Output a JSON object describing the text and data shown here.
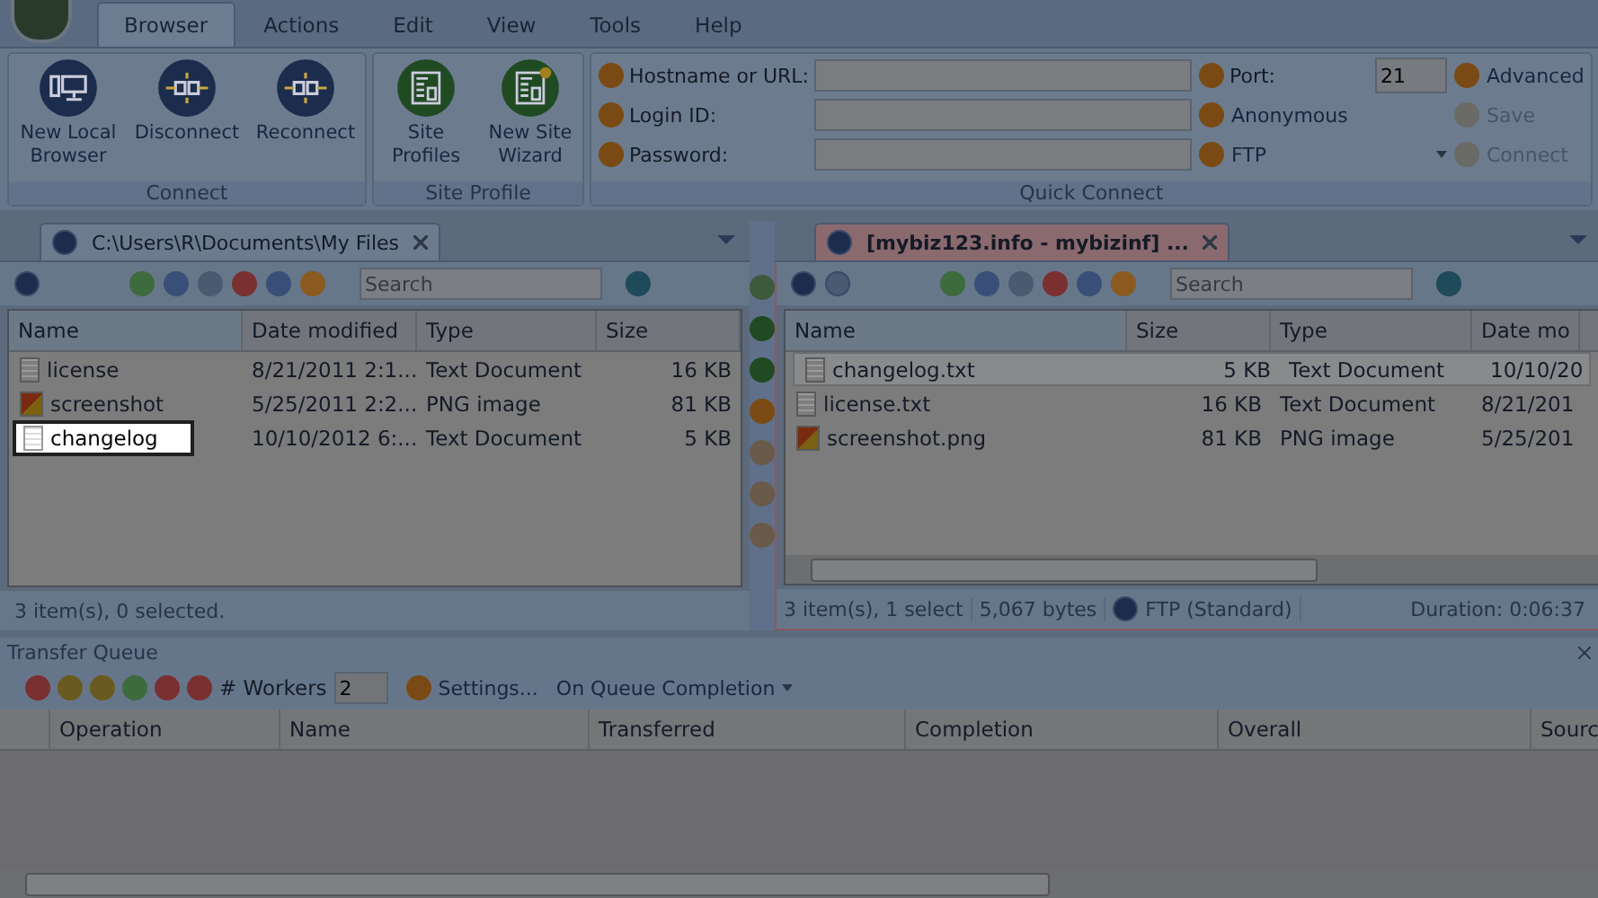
{
  "menu_tabs": [
    {
      "label": "Browser",
      "selected": true
    },
    {
      "label": "Actions",
      "selected": false
    },
    {
      "label": "Edit",
      "selected": false
    },
    {
      "label": "View",
      "selected": false
    },
    {
      "label": "Tools",
      "selected": false
    },
    {
      "label": "Help",
      "selected": false
    }
  ],
  "ribbon": {
    "connect": {
      "caption": "Connect",
      "buttons": [
        {
          "label": "New Local Browser",
          "kind": "local"
        },
        {
          "label": "Disconnect",
          "kind": "link"
        },
        {
          "label": "Reconnect",
          "kind": "link"
        }
      ]
    },
    "site_profile": {
      "caption": "Site Profile",
      "buttons": [
        {
          "label": "Site Profiles",
          "kind": "profile"
        },
        {
          "label": "New Site Wizard",
          "kind": "wizard"
        }
      ]
    },
    "quick_connect": {
      "caption": "Quick Connect",
      "fields": [
        {
          "label": "Hostname or URL:"
        },
        {
          "label": "Login ID:"
        },
        {
          "label": "Password:"
        }
      ],
      "port": {
        "label": "Port:",
        "value": "21"
      },
      "anonymous": "Anonymous",
      "protocol": "FTP",
      "actions": [
        {
          "label": "Advanced",
          "disabled": false
        },
        {
          "label": "Save",
          "disabled": true
        },
        {
          "label": "Connect",
          "disabled": true
        }
      ]
    }
  },
  "local_pane": {
    "tab_title": "C:\\Users\\R\\Documents\\My Files",
    "search": {
      "placeholder": "Search"
    },
    "columns": [
      "Name",
      "Date modified",
      "Type",
      "Size"
    ],
    "rows": [
      {
        "name": "license",
        "date": "8/21/2011 2:1...",
        "type": "Text Document",
        "size": "16 KB",
        "kind": "text",
        "highlighted": false
      },
      {
        "name": "screenshot",
        "date": "5/25/2011 2:2...",
        "type": "PNG image",
        "size": "81 KB",
        "kind": "image",
        "highlighted": false
      },
      {
        "name": "changelog",
        "date": "10/10/2012 6:...",
        "type": "Text Document",
        "size": "5 KB",
        "kind": "text",
        "highlighted": true
      }
    ],
    "status": "3 item(s), 0 selected."
  },
  "remote_pane": {
    "tab_title": "[mybiz123.info - mybizinf] ...",
    "search": {
      "placeholder": "Search"
    },
    "columns": [
      "Name",
      "Size",
      "Type",
      "Date mo"
    ],
    "rows": [
      {
        "name": "changelog.txt",
        "size": "5 KB",
        "type": "Text Document",
        "date": "10/10/20",
        "kind": "text",
        "selected": true
      },
      {
        "name": "license.txt",
        "size": "16 KB",
        "type": "Text Document",
        "date": "8/21/201",
        "kind": "text",
        "selected": false
      },
      {
        "name": "screenshot.png",
        "size": "81 KB",
        "type": "PNG image",
        "date": "5/25/201",
        "kind": "image",
        "selected": false
      }
    ],
    "status": [
      "3 item(s), 1 select",
      "5,067 bytes",
      "FTP (Standard)",
      "Duration: 0:06:37"
    ]
  },
  "transfer_queue": {
    "title": "Transfer Queue",
    "workers_label": "# Workers",
    "workers": "2",
    "settings": "Settings...",
    "on_completion": "On Queue Completion",
    "columns": [
      "Operation",
      "Name",
      "Transferred",
      "Completion",
      "Overall",
      "Sourc"
    ]
  }
}
